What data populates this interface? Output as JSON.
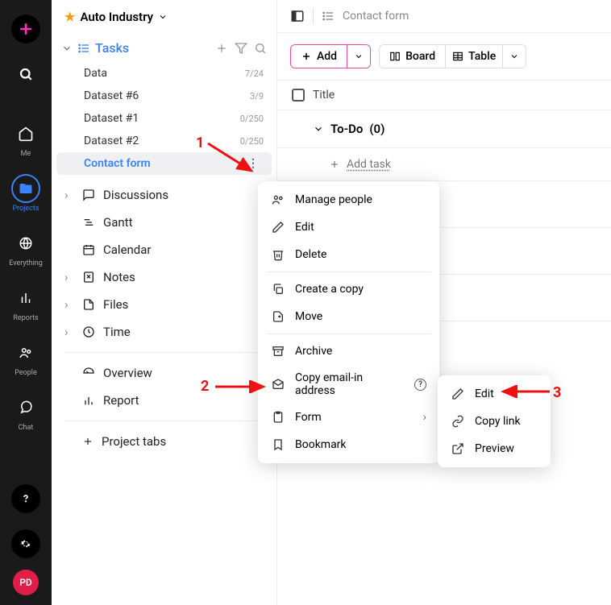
{
  "rail": {
    "items": [
      {
        "name": "me",
        "label": "Me"
      },
      {
        "name": "projects",
        "label": "Projects"
      },
      {
        "name": "everything",
        "label": "Everything"
      },
      {
        "name": "reports",
        "label": "Reports"
      },
      {
        "name": "people",
        "label": "People"
      },
      {
        "name": "chat",
        "label": "Chat"
      }
    ],
    "avatar": "PD"
  },
  "sidebar": {
    "project": "Auto Industry",
    "tasks_section": "Tasks",
    "task_lists": [
      {
        "name": "Data",
        "count": "7/24"
      },
      {
        "name": "Dataset #6",
        "count": "3/9"
      },
      {
        "name": "Dataset #1",
        "count": "0/250"
      },
      {
        "name": "Dataset #2",
        "count": "0/250"
      },
      {
        "name": "Contact form",
        "count": ""
      }
    ],
    "nav": [
      {
        "label": "Discussions"
      },
      {
        "label": "Gantt"
      },
      {
        "label": "Calendar"
      },
      {
        "label": "Notes"
      },
      {
        "label": "Files"
      },
      {
        "label": "Time"
      }
    ],
    "overview": "Overview",
    "report": "Report",
    "project_tabs": "Project tabs"
  },
  "topbar": {
    "title": "Contact form"
  },
  "toolbar": {
    "add": "Add",
    "board": "Board",
    "table": "Table"
  },
  "table": {
    "header": "Title",
    "group": "To-Do",
    "group_count": "(0)",
    "add_task": "Add task"
  },
  "context_menu": {
    "items": [
      {
        "label": "Manage people"
      },
      {
        "label": "Edit"
      },
      {
        "label": "Delete"
      },
      {
        "label": "Create a copy"
      },
      {
        "label": "Move"
      },
      {
        "label": "Archive"
      },
      {
        "label": "Copy email-in address"
      },
      {
        "label": "Form"
      },
      {
        "label": "Bookmark"
      }
    ]
  },
  "submenu": {
    "items": [
      {
        "label": "Edit"
      },
      {
        "label": "Copy link"
      },
      {
        "label": "Preview"
      }
    ]
  },
  "annotations": {
    "n1": "1",
    "n2": "2",
    "n3": "3"
  }
}
